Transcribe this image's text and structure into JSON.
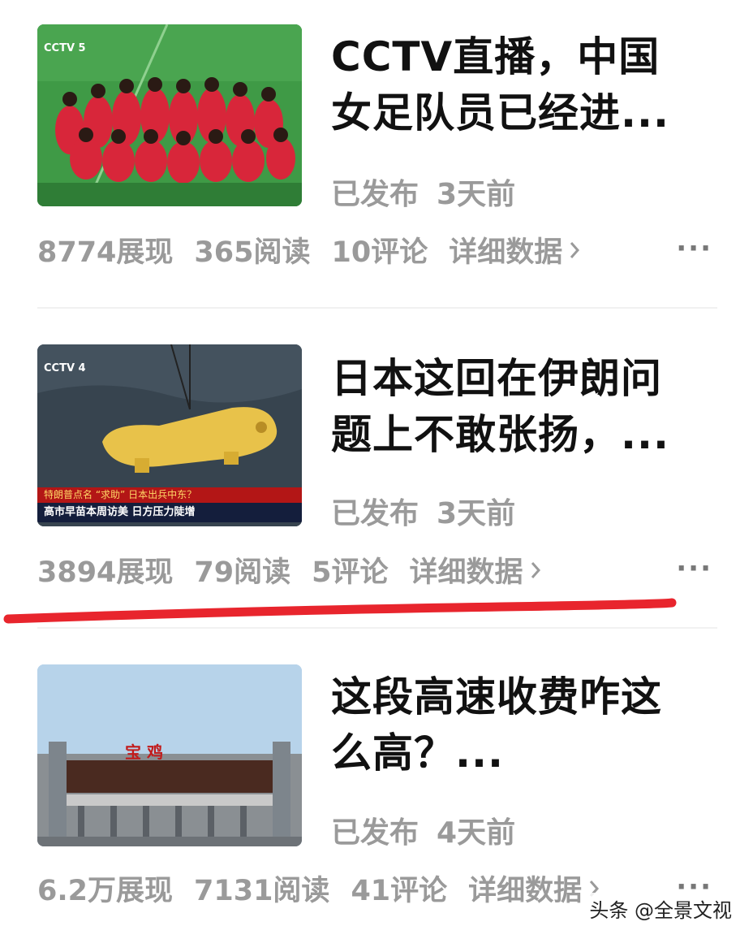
{
  "articles": [
    {
      "thumb_badge": "CCTV 5",
      "title_line1": "CCTV直播，中国",
      "title_line2": "女足队员已经进...",
      "status": "已发布",
      "time": "3天前",
      "impressions": "8774展现",
      "reads": "365阅读",
      "comments": "10评论",
      "detail": "详细数据",
      "more": "···"
    },
    {
      "thumb_badge": "CCTV 4",
      "thumb_caption_top": "特朗普点名 “求助” 日本出兵中东？",
      "thumb_caption_bottom": "高市早苗本周访美 日方压力陡增",
      "title_line1": "日本这回在伊朗问",
      "title_line2": "题上不敢张扬，...",
      "status": "已发布",
      "time": "3天前",
      "impressions": "3894展现",
      "reads": "79阅读",
      "comments": "5评论",
      "detail": "详细数据",
      "more": "···"
    },
    {
      "thumb_sign": "宝 鸡",
      "title_line1": "这段高速收费咋这",
      "title_line2": "么高？...",
      "status": "已发布",
      "time": "4天前",
      "impressions": "6.2万展现",
      "reads": "7131阅读",
      "comments": "41评论",
      "detail": "详细数据",
      "more": "···"
    }
  ],
  "annotation_color": "#e8252d",
  "watermark": "头条 @全景文视"
}
